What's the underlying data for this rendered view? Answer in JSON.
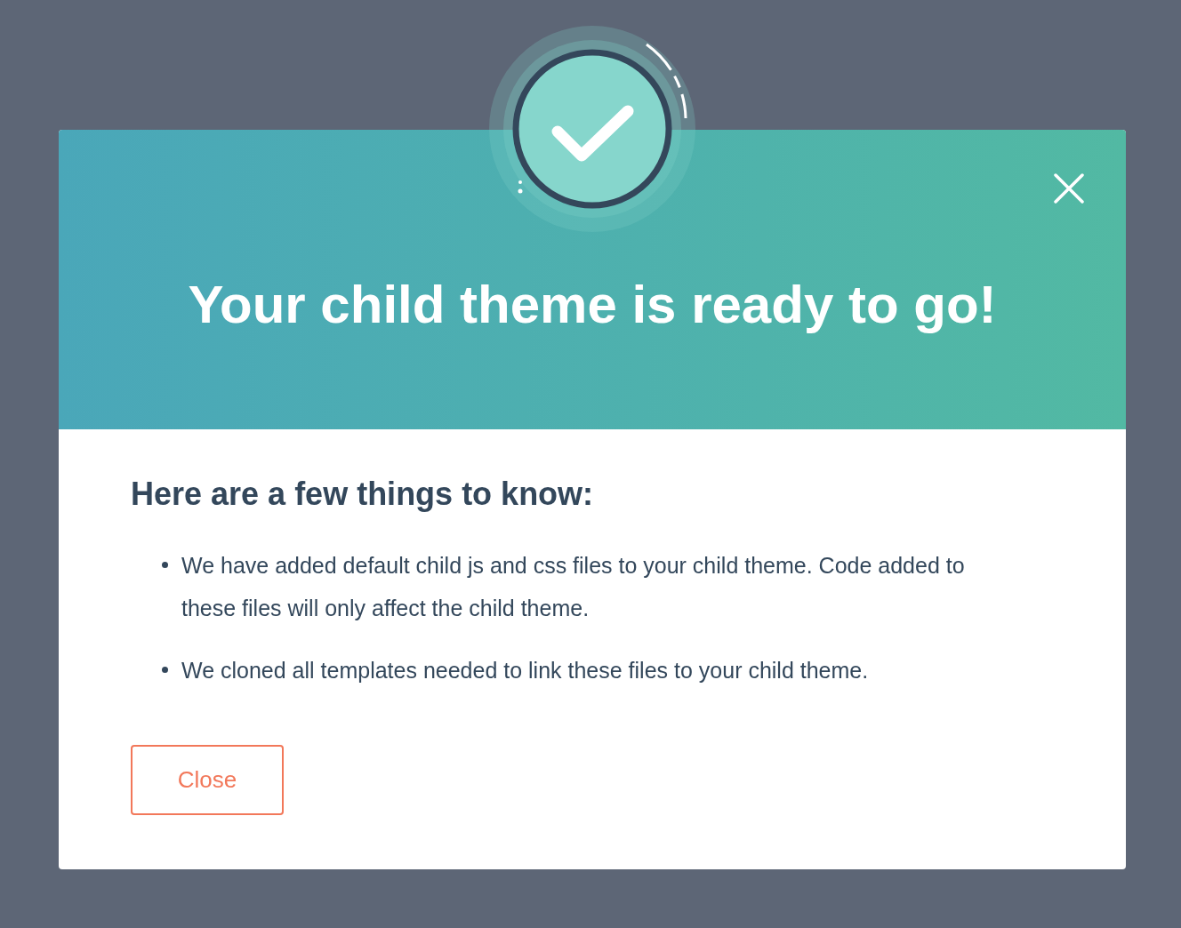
{
  "dialog": {
    "title": "Your child theme is ready to go!",
    "heading": "Here are a few things to know:",
    "bullets": [
      "We have added default child js and css files to your child theme. Code added to these files will only affect the child theme.",
      "We cloned all templates needed to link these files to your child theme."
    ],
    "close_button": "Close"
  }
}
